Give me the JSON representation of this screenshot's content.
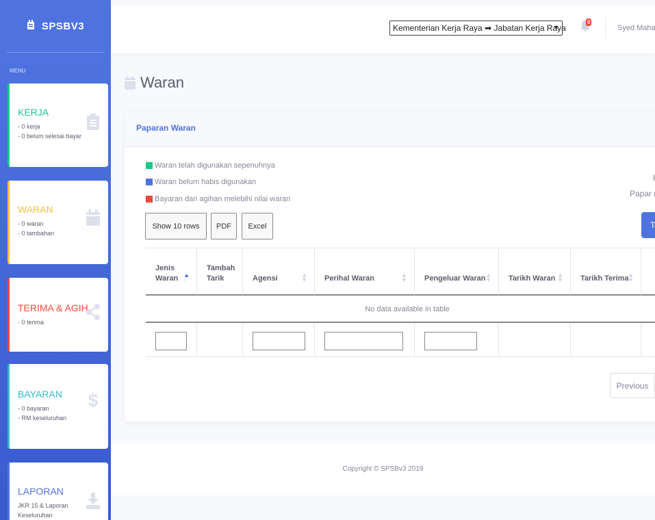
{
  "brand": {
    "name": "SPSBV3"
  },
  "sidebar": {
    "menu_heading": "MENU",
    "cards": [
      {
        "title": "KERJA",
        "color": "#1cc88a",
        "lines": [
          "- 0 kerja",
          "- 0 belum selesai bayar"
        ],
        "icon": "clipboard-icon"
      },
      {
        "title": "WARAN",
        "color": "#f6c23e",
        "lines": [
          "- 0 waran",
          "- 0 tambahan"
        ],
        "icon": "calendar-icon"
      },
      {
        "title": "TERIMA & AGIH",
        "color": "#e74a3b",
        "lines": [
          "- 0 terima"
        ],
        "icon": "share-icon"
      },
      {
        "title": "BAYARAN",
        "color": "#36b9cc",
        "lines": [
          "- 0 bayaran",
          "- RM keseluruhan"
        ],
        "icon": "dollar-icon"
      },
      {
        "title": "LAPORAN",
        "color": "#4e73df",
        "lines": [
          "JKR 15 & Laporan",
          "Keseluruhan"
        ],
        "icon": "download-icon"
      }
    ]
  },
  "topbar": {
    "org_select": "Kementerian Kerja Raya ➡ Jabatan Kerja Raya",
    "notification_count": "0",
    "user_name": "Syed Mahadhir"
  },
  "page": {
    "title": "Waran"
  },
  "panel": {
    "title": "Paparan Waran",
    "legend": [
      {
        "color": "#1cc88a",
        "label": "Waran telah digunakan sepenuhnya"
      },
      {
        "color": "#4e73df",
        "label": "Waran belum habis digunakan"
      },
      {
        "color": "#e74a3b",
        "label": "Bayaran dan agihan melebihi nilai waran"
      }
    ],
    "buttons": {
      "show_rows": "Show 10 rows",
      "pdf": "PDF",
      "excel": "Excel"
    },
    "right_text_1": "F",
    "right_text_2": "Papar r",
    "blue_button": "Ta",
    "table": {
      "columns": [
        "Jenis Waran",
        "Tambah Tarik",
        "Agensi",
        "Perihal Waran",
        "Pengeluar Waran",
        "Tarikh Waran",
        "Tarikh Terima"
      ],
      "empty_message": "No data available in table"
    },
    "pagination": {
      "previous": "Previous"
    }
  },
  "footer": {
    "copyright": "Copyright © SPSBv3 2019"
  }
}
